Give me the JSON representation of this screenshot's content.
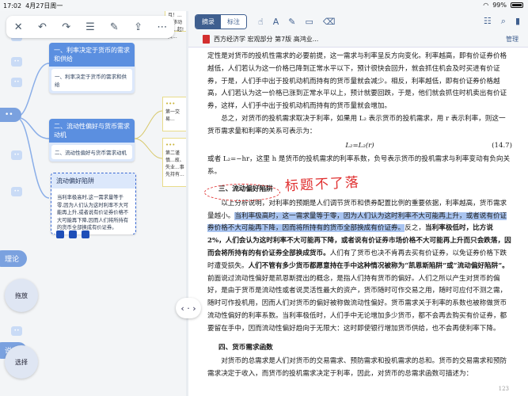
{
  "status": {
    "time": "17:02",
    "date": "4月27日周一",
    "wifi": "wifi-icon",
    "battery_pct": "99%"
  },
  "mindmap": {
    "node1": {
      "title": "一、利率决定于货币的需求和供给",
      "body": "一、利率决定于货币的需求和供给"
    },
    "node2": {
      "title": "二、流动性偏好与货币需求动机",
      "body": "二、流动性偏好与货币需求动机"
    },
    "node3": {
      "title": "流动偏好陷阱",
      "body": "当利率极高时,这一需求量等于零,因为人们认为这时利率不大可能再上升,或者说有价证券价格不大可能再下降,因而人们将所持有的货币全部换成有价证券。"
    },
    "note_top": "而且！...的移动或...起!资...",
    "note1": "第一交易...",
    "note2": "第二谨慎...故、失业...事先持有...",
    "left_labels": {
      "l1": "理论",
      "l2": "说明"
    },
    "fab_drag": "拖放",
    "fab_select": "选择"
  },
  "pdf": {
    "tab_excerpt": "摘录",
    "tab_mark": "标注",
    "doc_title": "西方经济学 宏观部分 第7版 高鸿业...",
    "manage": "管理",
    "hand_note": "标题不了落",
    "lines": {
      "p1": "定性是对货币的投机性需求的必要前提，这一需求与利率呈反方向变化。利率越高，即有价证券价格越低，人们若认为这一价格已降到正常水平以下，预计很快会回升，就会抓住机会及时买进有价证券，于是，人们手中出于投机动机而持有的货币量就会减少。相反，利率越低，即有价证券价格越高，人们若认为这一价格已涨到正常水平以上，预计就要回跌，于是，他们就会抓住时机卖出有价证券，这样，人们手中出于投机动机而持有的货币量就会增加。",
      "p2": "总之，对货币的投机需求取决于利率，如果用 L₂ 表示货币的投机需求，用 r 表示利率，则这一货币需求量和利率的关系可表示为：",
      "formula": "L₂=L₂(r)",
      "formula_num": "(14.7)",
      "p3": "或者 L₂=−hr，这里 h 是货币的投机需求的利率系数，负号表示货币的投机需求与利率变动有负向关系。",
      "sec3": "三、流动偏好陷阱",
      "p4a": "以上分析说明，对利率的预期是人们调节货币和债券配置比例的重要依据，利率越高，货币需求量越小。",
      "p4b": "当利率极高时，这一需求量等于零，因为人们认为这时利率不大可能再上升，或者说有价证券价格不大可能再下降，因而将所持有的货币全部换成有价证券。",
      "p4c": "反之，",
      "p4d": "当利率极低时，比方说 2%，人们会认为这时利率不大可能再下降，或者说有价证券市场价格不大可能再上升而只会跌落，因而会将所持有的有价证券全部换成货币。",
      "p4e": "人们有了货币也决不肯再去买有价证券，以免证券价格下跌时遭受损失。",
      "p4f": "人们不管有多少货币都愿意持在手中这种情况被称为“凯恩斯陷阱”或“流动偏好陷阱”。",
      "p4g": "前面说过流动性偏好是凯恩斯提出的概念，是指人们持有货币的偏好。人们之所以产生对货币的偏好，是由于货币是流动性或者说灵活性最大的资产，货币随时可作交易之用，随时可应付不测之需，随时可作投机用，因而人们对货币的偏好被称做流动性偏好。货币需求关于利率的系数也被称做货币流动性偏好的利率系数。当利率极低时，人们手中无论增加多少货币，都不会再去购买有价证券，都要留在手中，因而流动性偏好趋向于无限大：这时即使银行增加货币供给，也不会再使利率下降。",
      "sec4": "四、货币需求函数",
      "p5": "对货币的总需求是人们对货币的交易需求、预防需求和投机需求的总和。货币的交易需求和预防需求决定于收入，而货币的投机需求决定于利率，因此，对货币的总需求函数可描述为：",
      "page_no": "123"
    }
  }
}
